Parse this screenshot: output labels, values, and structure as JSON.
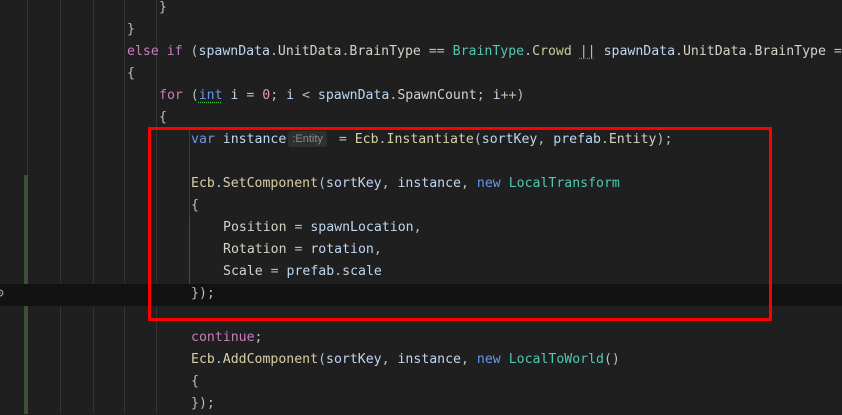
{
  "editor": {
    "lines": [
      {
        "indent": 5,
        "tokens": [
          [
            "p",
            "}"
          ]
        ]
      },
      {
        "indent": 4,
        "tokens": [
          [
            "p",
            "}"
          ]
        ]
      },
      {
        "indent": 4,
        "tokens": [
          [
            "kw",
            "else"
          ],
          [
            "p",
            " "
          ],
          [
            "kw",
            "if"
          ],
          [
            "p",
            " ("
          ],
          [
            "id",
            "spawnData"
          ],
          [
            "p",
            "."
          ],
          [
            "prop",
            "UnitData"
          ],
          [
            "p",
            "."
          ],
          [
            "prop",
            "BrainType"
          ],
          [
            "p",
            " == "
          ],
          [
            "type",
            "BrainType"
          ],
          [
            "p",
            "."
          ],
          [
            "enum",
            "Crowd"
          ],
          [
            "p",
            " "
          ],
          [
            "squig",
            "||"
          ],
          [
            "p",
            " "
          ],
          [
            "id",
            "spawnData"
          ],
          [
            "p",
            "."
          ],
          [
            "prop",
            "UnitData"
          ],
          [
            "p",
            "."
          ],
          [
            "prop",
            "BrainType"
          ],
          [
            "p",
            " ="
          ]
        ]
      },
      {
        "indent": 4,
        "tokens": [
          [
            "p",
            "{"
          ]
        ]
      },
      {
        "indent": 5,
        "tokens": [
          [
            "kw",
            "for"
          ],
          [
            "p",
            " ("
          ],
          [
            "kw2 squig",
            "int"
          ],
          [
            "p",
            " "
          ],
          [
            "id",
            "i"
          ],
          [
            "p",
            " = "
          ],
          [
            "num",
            "0"
          ],
          [
            "p",
            "; "
          ],
          [
            "id",
            "i"
          ],
          [
            "p",
            " < "
          ],
          [
            "id",
            "spawnData"
          ],
          [
            "p",
            "."
          ],
          [
            "prop",
            "SpawnCount"
          ],
          [
            "p",
            "; "
          ],
          [
            "id",
            "i"
          ],
          [
            "p",
            "++)"
          ]
        ]
      },
      {
        "indent": 5,
        "tokens": [
          [
            "p",
            "{"
          ]
        ]
      },
      {
        "indent": 6,
        "tokens": [
          [
            "kw2",
            "var"
          ],
          [
            "p",
            " "
          ],
          [
            "id",
            "instance"
          ],
          [
            "hint",
            ":Entity"
          ],
          [
            "p",
            " = "
          ],
          [
            "cls",
            "Ecb"
          ],
          [
            "p",
            "."
          ],
          [
            "cls",
            "Instantiate"
          ],
          [
            "p",
            "("
          ],
          [
            "id",
            "sortKey"
          ],
          [
            "p",
            ", "
          ],
          [
            "id",
            "prefab"
          ],
          [
            "p",
            "."
          ],
          [
            "prop",
            "Entity"
          ],
          [
            "p",
            ");"
          ]
        ]
      },
      {
        "indent": 6,
        "tokens": []
      },
      {
        "indent": 6,
        "tokens": [
          [
            "cls",
            "Ecb"
          ],
          [
            "p",
            "."
          ],
          [
            "cls",
            "SetComponent"
          ],
          [
            "p",
            "("
          ],
          [
            "id",
            "sortKey"
          ],
          [
            "p",
            ", "
          ],
          [
            "id",
            "instance"
          ],
          [
            "p",
            ", "
          ],
          [
            "kw2",
            "new"
          ],
          [
            "p",
            " "
          ],
          [
            "type",
            "LocalTransform"
          ]
        ]
      },
      {
        "indent": 6,
        "tokens": [
          [
            "p",
            "{"
          ]
        ]
      },
      {
        "indent": 7,
        "tokens": [
          [
            "prop",
            "Position"
          ],
          [
            "p",
            " = "
          ],
          [
            "id",
            "spawnLocation"
          ],
          [
            "p",
            ","
          ]
        ]
      },
      {
        "indent": 7,
        "tokens": [
          [
            "prop",
            "Rotation"
          ],
          [
            "p",
            " = "
          ],
          [
            "id",
            "rotation"
          ],
          [
            "p",
            ","
          ]
        ]
      },
      {
        "indent": 7,
        "tokens": [
          [
            "prop",
            "Scale"
          ],
          [
            "p",
            " = "
          ],
          [
            "id",
            "prefab"
          ],
          [
            "p",
            "."
          ],
          [
            "id",
            "scale"
          ]
        ]
      },
      {
        "indent": 6,
        "tokens": [
          [
            "p",
            "});"
          ]
        ]
      },
      {
        "indent": 6,
        "tokens": []
      },
      {
        "indent": 6,
        "tokens": [
          [
            "kw",
            "continue"
          ],
          [
            "p",
            ";"
          ]
        ]
      },
      {
        "indent": 6,
        "tokens": [
          [
            "cls",
            "Ecb"
          ],
          [
            "p",
            "."
          ],
          [
            "cls",
            "AddComponent"
          ],
          [
            "p",
            "("
          ],
          [
            "id",
            "sortKey"
          ],
          [
            "p",
            ", "
          ],
          [
            "id",
            "instance"
          ],
          [
            "p",
            ", "
          ],
          [
            "kw2",
            "new"
          ],
          [
            "p",
            " "
          ],
          [
            "type",
            "LocalToWorld"
          ],
          [
            "p",
            "()"
          ]
        ]
      },
      {
        "indent": 6,
        "tokens": [
          [
            "p",
            "{"
          ]
        ]
      },
      {
        "indent": 6,
        "tokens": [
          [
            "p",
            "});"
          ]
        ]
      }
    ]
  }
}
